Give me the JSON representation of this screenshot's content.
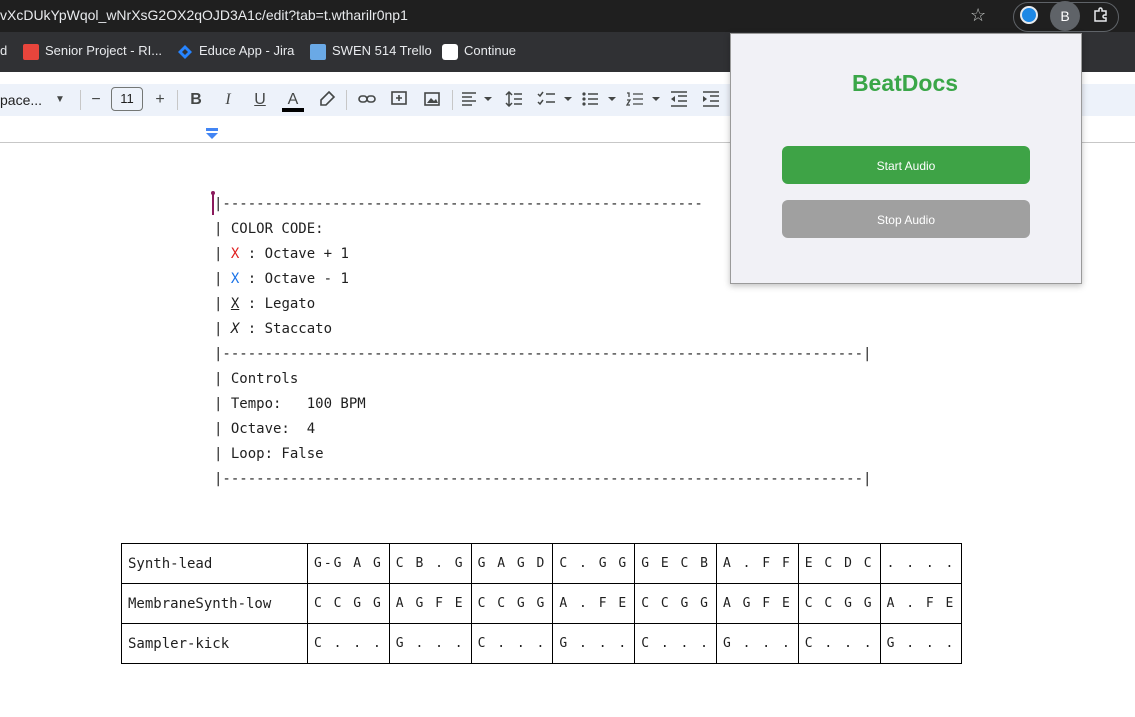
{
  "browser": {
    "url": "vXcDUkYpWqol_wNrXsG2OX2qOJD3A1c/edit?tab=t.wtharilr0np1",
    "extension_avatar": "B",
    "bookmarks": [
      {
        "label": "d",
        "icon": ""
      },
      {
        "label": "Senior Project - RI...",
        "icon": "rit-icon"
      },
      {
        "label": "Educe App - Jira",
        "icon": "jira-icon"
      },
      {
        "label": "SWEN 514 Trello",
        "icon": "trello-icon"
      },
      {
        "label": "Continue",
        "icon": "continue-icon"
      }
    ]
  },
  "toolbar": {
    "font": "pace...",
    "font_size": "11",
    "minus": "−",
    "plus": "+",
    "bold": "B",
    "italic": "I",
    "underline": "U",
    "text_color": "A"
  },
  "doc": {
    "border_top": "|---------------------------------------------------------",
    "color_code_title": "| COLOR CODE:",
    "legend": [
      {
        "prefix": "| ",
        "key": "X",
        "text": " : Octave + 1"
      },
      {
        "prefix": "| ",
        "key": "X",
        "text": " : Octave - 1"
      },
      {
        "prefix": "| ",
        "key": "X",
        "text": " : Legato"
      },
      {
        "prefix": "| ",
        "key": "X",
        "text": " : Staccato"
      }
    ],
    "border_mid": "|----------------------------------------------------------------------------|",
    "controls_title": "| Controls",
    "tempo": "| Tempo:   100 BPM",
    "octave": "| Octave:  4",
    "loop": "| Loop: False",
    "border_bottom": "|----------------------------------------------------------------------------|"
  },
  "sequencer": [
    {
      "name": "Synth-lead",
      "cells": [
        "G-G A G",
        "C B . G",
        "G A G D",
        "C . G G",
        "G E C B",
        "A . F F",
        "E C D C",
        ". . . ."
      ]
    },
    {
      "name": "MembraneSynth-low",
      "cells": [
        "C C G G",
        "A G F E",
        "C C G G",
        "A . F E",
        "C C G G",
        "A G F E",
        "C C G G",
        "A . F E"
      ]
    },
    {
      "name": "Sampler-kick",
      "cells": [
        "C . . .",
        "G . . .",
        "C . . .",
        "G . . .",
        "C . . .",
        "G . . .",
        "C . . .",
        "G . . ."
      ]
    }
  ],
  "popup": {
    "title": "BeatDocs",
    "start_label": "Start Audio",
    "stop_label": "Stop Audio"
  },
  "colors": {
    "accent_green": "#3ea346",
    "octave_up": "#e02020",
    "octave_down": "#1a73e8",
    "stop_gray": "#a0a0a0"
  }
}
